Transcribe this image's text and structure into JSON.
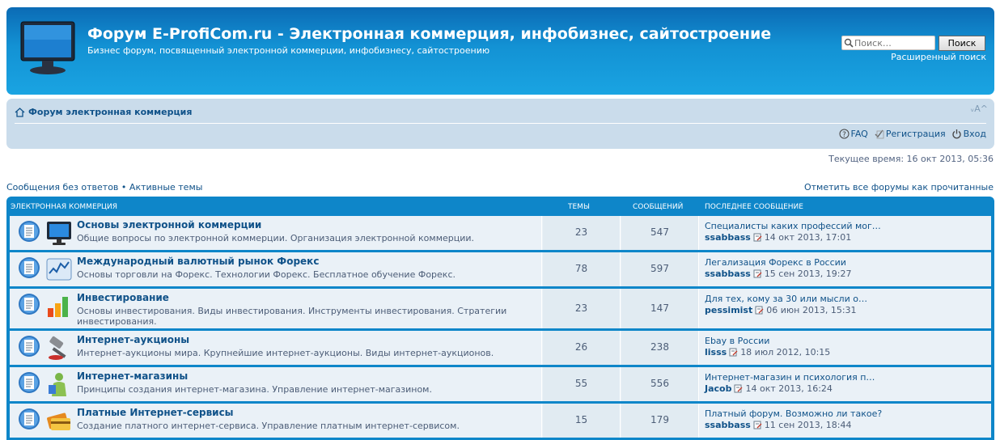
{
  "header": {
    "title": "Форум E-ProfiCom.ru - Электронная коммерция, инфобизнес, сайтостроение",
    "description": "Бизнес форум, посвященный электронной коммерции, инфобизнесу, сайтостроению",
    "search_placeholder": "Поиск…",
    "search_button": "Поиск",
    "advanced_search": "Расширенный поиск"
  },
  "nav": {
    "breadcrumb": "Форум электронная коммерция",
    "font_size_control": "ᵥA^",
    "faq": "FAQ",
    "register": "Регистрация",
    "login": "Вход"
  },
  "current_time": "Текущее время: 16 окт 2013, 05:36",
  "quick_links": {
    "unanswered": "Сообщения без ответов",
    "separator": "•",
    "active": "Активные темы",
    "mark_read": "Отметить все форумы как прочитанные"
  },
  "table": {
    "category": "Электронная коммерция",
    "col_topics": "Темы",
    "col_posts": "Сообщений",
    "col_last": "Последнее сообщение",
    "forums": [
      {
        "icon": "monitor-icon",
        "title": "Основы электронной коммерции",
        "desc": "Общие вопросы по электронной коммерции. Организация электронной коммерции.",
        "topics": "23",
        "posts": "547",
        "last_title": "Специалисты каких профессий мог…",
        "last_user": "ssabbass",
        "last_date": "14 окт 2013, 17:01"
      },
      {
        "icon": "forex-chart-icon",
        "title": "Международный валютный рынок Форекс",
        "desc": "Основы торговли на Форекс. Технологии Форекс. Бесплатное обучение Форекс.",
        "topics": "78",
        "posts": "597",
        "last_title": "Легализация Форекс в России",
        "last_user": "ssabbass",
        "last_date": "15 сен 2013, 19:27"
      },
      {
        "icon": "bar-chart-icon",
        "title": "Инвестирование",
        "desc": "Основы инвестирования. Виды инвестирования. Инструменты инвестирования. Стратегии инвестирования.",
        "topics": "23",
        "posts": "147",
        "last_title": "Для тех, кому за 30 или мысли о…",
        "last_user": "pessimist",
        "last_date": "06 июн 2013, 15:31"
      },
      {
        "icon": "gavel-icon",
        "title": "Интернет-аукционы",
        "desc": "Интернет-аукционы мира. Крупнейшие интернет-аукционы. Виды интернет-аукционов.",
        "topics": "26",
        "posts": "238",
        "last_title": "Ebay в России",
        "last_user": "lisss",
        "last_date": "18 июл 2012, 10:15"
      },
      {
        "icon": "shopper-icon",
        "title": "Интернет-магазины",
        "desc": "Принципы создания интернет-магазина. Управление интернет-магазином.",
        "topics": "55",
        "posts": "556",
        "last_title": "Интернет-магазин и психология п…",
        "last_user": "Jacob",
        "last_date": "14 окт 2013, 16:24"
      },
      {
        "icon": "credit-cards-icon",
        "title": "Платные Интернет-сервисы",
        "desc": "Создание платного интернет-сервиса. Управление платным интернет-сервисом.",
        "topics": "15",
        "posts": "179",
        "last_title": "Платный форум. Возможно ли такое?",
        "last_user": "ssabbass",
        "last_date": "11 сен 2013, 18:44"
      }
    ]
  }
}
